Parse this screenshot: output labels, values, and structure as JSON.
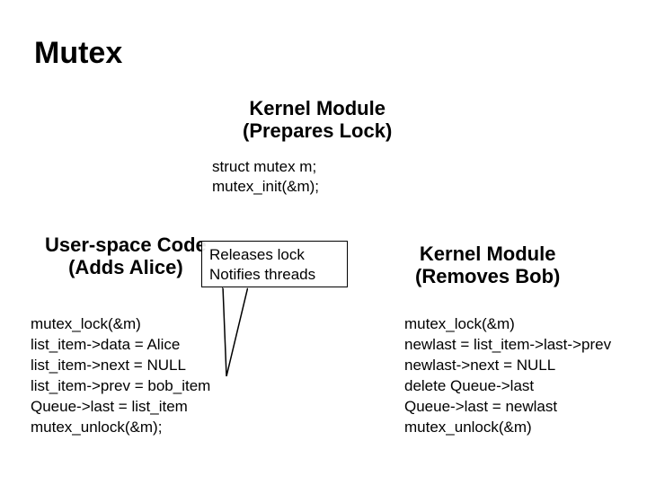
{
  "title": "Mutex",
  "kernel_top": {
    "line1": "Kernel Module",
    "line2": "(Prepares Lock)"
  },
  "code_top": {
    "line1": "struct mutex m;",
    "line2": "mutex_init(&m);"
  },
  "user_heading": {
    "line1": "User-space Code",
    "line2": "(Adds Alice)"
  },
  "kernel_right": {
    "line1": "Kernel Module",
    "line2": "(Removes Bob)"
  },
  "callout": {
    "line1": "Releases lock",
    "line2": "Notifies threads"
  },
  "code_left": {
    "l1": "mutex_lock(&m)",
    "l2": "list_item->data = Alice",
    "l3": "list_item->next = NULL",
    "l4": "list_item->prev = bob_item",
    "l5": "Queue->last = list_item",
    "l6": "mutex_unlock(&m);"
  },
  "code_right": {
    "l1": "mutex_lock(&m)",
    "l2": "newlast = list_item->last->prev",
    "l3": "newlast->next = NULL",
    "l4": "delete Queue->last",
    "l5": "Queue->last = newlast",
    "l6": "mutex_unlock(&m)"
  }
}
